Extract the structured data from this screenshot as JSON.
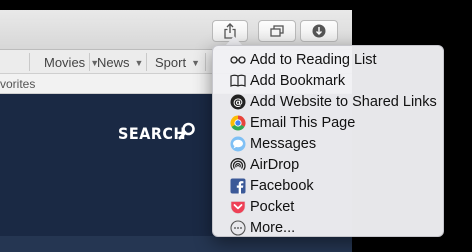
{
  "nav": {
    "items": [
      {
        "label": "Movies"
      },
      {
        "label": "News"
      },
      {
        "label": "Sport"
      }
    ]
  },
  "favorites": {
    "label": "vorites"
  },
  "page": {
    "search_label": "SEARCH"
  },
  "share_menu": {
    "items": [
      {
        "label": "Add to Reading List",
        "icon": "reading-list-icon"
      },
      {
        "label": "Add Bookmark",
        "icon": "bookmark-icon"
      },
      {
        "label": "Add Website to Shared Links",
        "icon": "shared-links-icon"
      },
      {
        "label": "Email This Page",
        "icon": "chrome-email-icon"
      },
      {
        "label": "Messages",
        "icon": "messages-icon"
      },
      {
        "label": "AirDrop",
        "icon": "airdrop-icon"
      },
      {
        "label": "Facebook",
        "icon": "facebook-icon"
      },
      {
        "label": "Pocket",
        "icon": "pocket-icon"
      },
      {
        "label": "More...",
        "icon": "more-icon"
      }
    ]
  },
  "colors": {
    "page_bg": "#1a2944",
    "menu_bg": "#f0f0f4",
    "facebook": "#3b5998",
    "pocket": "#ee4056",
    "messages": "#4a90e2"
  }
}
